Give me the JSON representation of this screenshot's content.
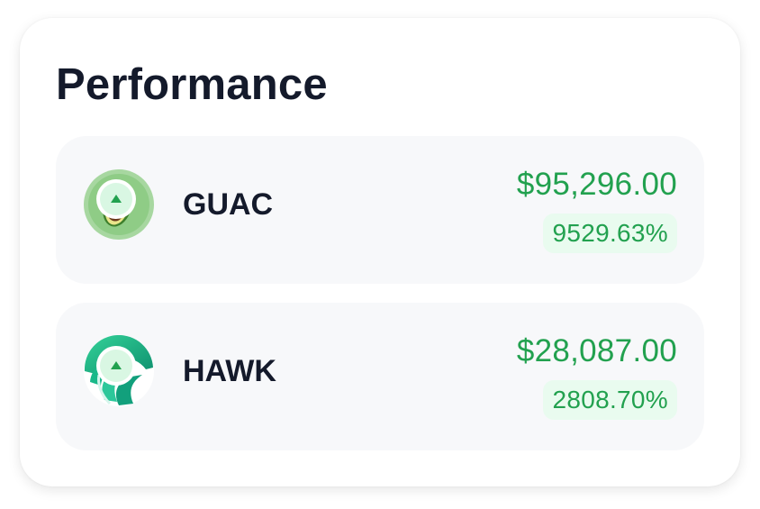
{
  "card": {
    "title": "Performance"
  },
  "colors": {
    "gain": "#22a14f",
    "gain_bg": "#e9fbef",
    "row_bg": "#f7f8fa",
    "text": "#141a2b"
  },
  "assets": [
    {
      "symbol": "GUAC",
      "value": "$95,296.00",
      "change": "9529.63%",
      "trend": "up",
      "icon": "avocado-icon"
    },
    {
      "symbol": "HAWK",
      "value": "$28,087.00",
      "change": "2808.70%",
      "trend": "up",
      "icon": "hawk-icon"
    }
  ]
}
